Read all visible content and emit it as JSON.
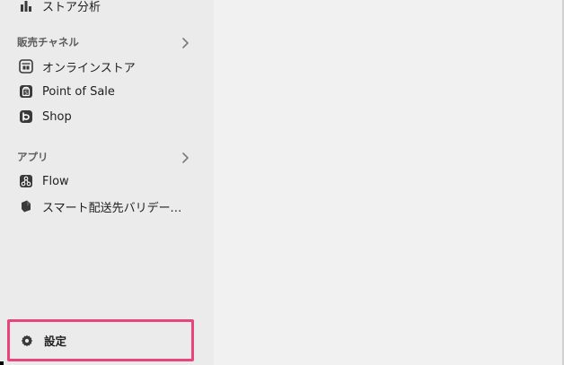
{
  "sidebar": {
    "top_item": {
      "label": "ストア分析",
      "icon": "bar-chart-icon"
    },
    "sales_channels": {
      "header": "販売チャネル",
      "items": [
        {
          "label": "オンラインストア",
          "icon": "online-store-icon"
        },
        {
          "label": "Point of Sale",
          "icon": "point-of-sale-icon"
        },
        {
          "label": "Shop",
          "icon": "shop-app-icon"
        }
      ]
    },
    "apps": {
      "header": "アプリ",
      "items": [
        {
          "label": "Flow",
          "icon": "flow-icon"
        },
        {
          "label": "スマート配送先バリデーシ…",
          "icon": "address-validation-icon"
        }
      ]
    },
    "settings": {
      "label": "設定",
      "icon": "gear-icon"
    }
  },
  "colors": {
    "highlight_border": "#e8457a",
    "sidebar_bg": "#ebebeb",
    "main_bg": "#f1f1f1"
  }
}
